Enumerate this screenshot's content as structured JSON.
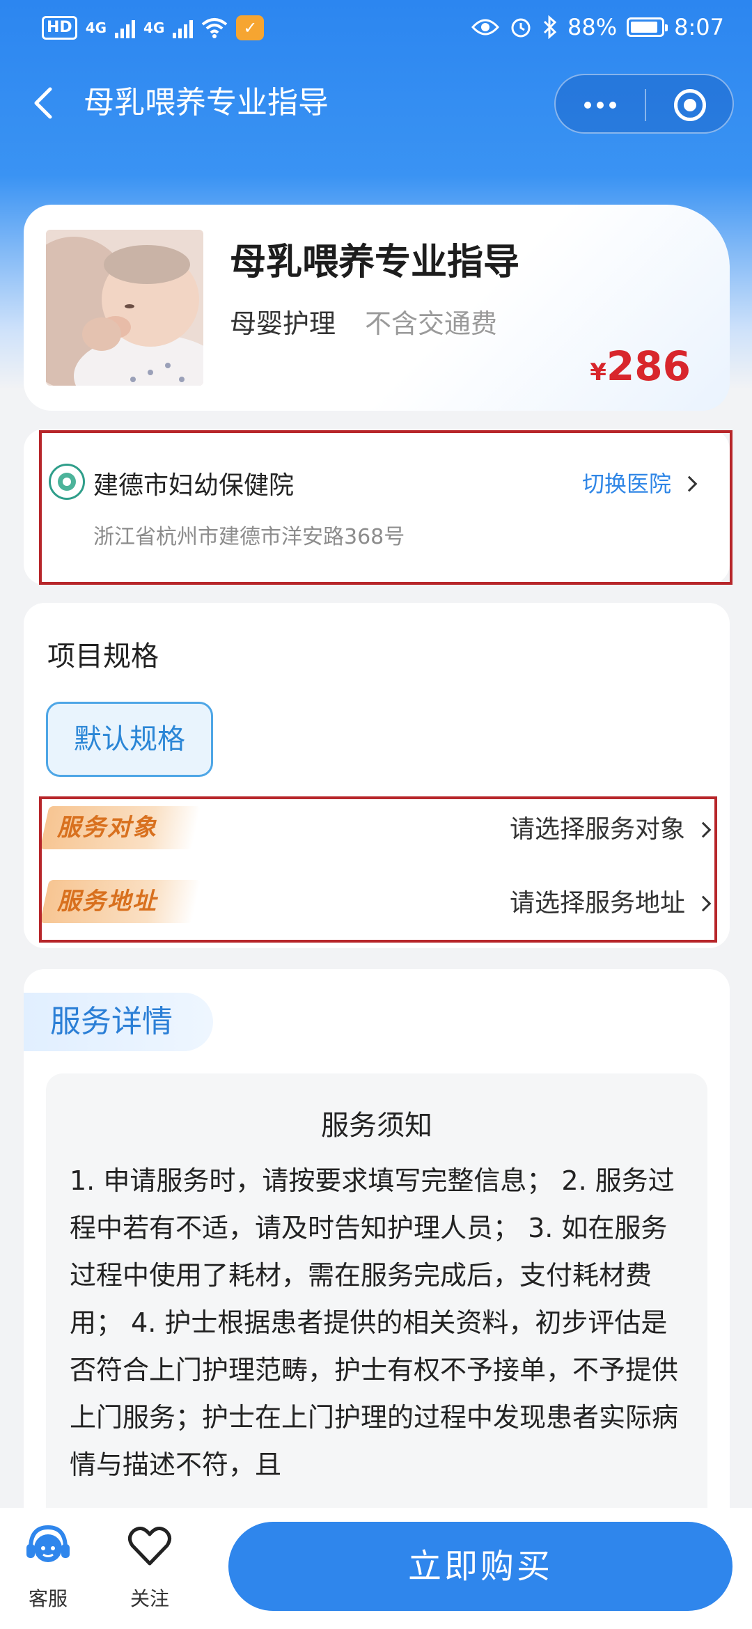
{
  "status_bar": {
    "hd_label": "HD",
    "sim1_net": "4G",
    "sim2_net": "4G",
    "battery": "88%",
    "time": "8:07"
  },
  "nav": {
    "title": "母乳喂养专业指导"
  },
  "product": {
    "title": "母乳喂养专业指导",
    "category": "母婴护理",
    "note": "不含交通费",
    "currency": "¥",
    "price": "286"
  },
  "hospital": {
    "name": "建德市妇幼保健院",
    "switch_label": "切换医院",
    "address": "浙江省杭州市建德市洋安路368号"
  },
  "spec": {
    "title": "项目规格",
    "selected_option": "默认规格",
    "rows": [
      {
        "label": "服务对象",
        "value": "请选择服务对象"
      },
      {
        "label": "服务地址",
        "value": "请选择服务地址"
      }
    ]
  },
  "details": {
    "tab_label": "服务详情",
    "notice_title": "服务须知",
    "notice_text": "1. 申请服务时，请按要求填写完整信息； 2. 服务过程中若有不适，请及时告知护理人员； 3. 如在服务过程中使用了耗材，需在服务完成后，支付耗材费用； 4. 护士根据患者提供的相关资料，初步评估是否符合上门护理范畴，护士有权不予接单，不予提供上门服务；护士在上门护理的过程中发现患者实际病情与描述不符，且"
  },
  "bottom": {
    "service_label": "客服",
    "follow_label": "关注",
    "buy_label": "立即购买"
  },
  "colors": {
    "primary": "#2f86ec",
    "price": "#d8262c",
    "highlight_border": "#b7262a",
    "tag_orange": "#d8701e"
  }
}
